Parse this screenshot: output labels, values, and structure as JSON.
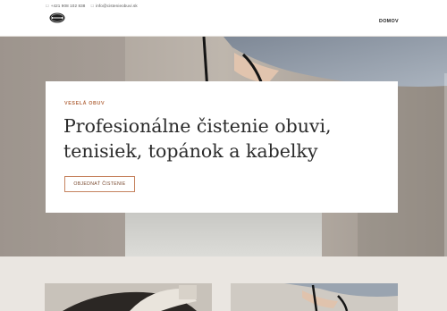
{
  "header": {
    "phone": "+421 908 102 838",
    "email": "info@cistenieobuvi.sk",
    "phone_icon": "phone-icon",
    "email_icon": "mail-icon",
    "logo_icon": "shoe-logo-icon",
    "nav_home": "DOMOV"
  },
  "hero": {
    "eyebrow": "VESELÁ OBUV",
    "headline_line1": "Profesionálne čistenie obuvi,",
    "headline_line2": "tenisiek, topánok a kabelky",
    "cta_label": "OBJEDNAŤ ČISTENIE"
  },
  "colors": {
    "accent": "#b66f49",
    "page_bg": "#ffffff",
    "section_bg": "#eae6e1"
  }
}
